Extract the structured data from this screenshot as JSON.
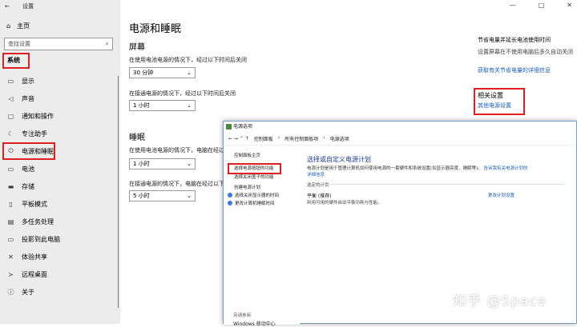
{
  "settings": {
    "window_title": "设置",
    "back_glyph": "←",
    "home_label": "主页",
    "search_placeholder": "查找设置",
    "section": "系统",
    "nav_items": [
      {
        "icon": "display-icon",
        "glyph": "▭",
        "label": "显示"
      },
      {
        "icon": "sound-icon",
        "glyph": "◁",
        "label": "声音"
      },
      {
        "icon": "notification-icon",
        "glyph": "▢",
        "label": "通知和操作"
      },
      {
        "icon": "focus-icon",
        "glyph": "☾",
        "label": "专注助手"
      },
      {
        "icon": "power-icon",
        "glyph": "⏻",
        "label": "电源和睡眠"
      },
      {
        "icon": "battery-icon",
        "glyph": "▭",
        "label": "电池"
      },
      {
        "icon": "storage-icon",
        "glyph": "▬",
        "label": "存储"
      },
      {
        "icon": "tablet-icon",
        "glyph": "▯",
        "label": "平板模式"
      },
      {
        "icon": "multitask-icon",
        "glyph": "▤",
        "label": "多任务处理"
      },
      {
        "icon": "project-icon",
        "glyph": "▭",
        "label": "投影到此电脑"
      },
      {
        "icon": "shared-icon",
        "glyph": "✕",
        "label": "体验共享"
      },
      {
        "icon": "remote-icon",
        "glyph": "≻",
        "label": "远程桌面"
      },
      {
        "icon": "about-icon",
        "glyph": "ⓘ",
        "label": "关于"
      }
    ],
    "window_controls": {
      "minimize": "—",
      "maximize": "□",
      "close": "✕"
    }
  },
  "main": {
    "title": "电源和睡眠",
    "screen": {
      "heading": "屏幕",
      "battery_label": "在使用电池电源的情况下，经过以下时间后关闭",
      "battery_value": "30 分钟",
      "plugged_label": "在接通电源的情况下，经过以下时间后关闭",
      "plugged_value": "1 小时"
    },
    "sleep": {
      "heading": "睡眠",
      "battery_label": "在使用电池电源的情况下，电脑在经过以下",
      "battery_value": "1 小时",
      "plugged_label": "在接通电源的情况下，电脑在经过以下",
      "plugged_value": "5 小时"
    },
    "chevron": "⌄",
    "right": {
      "tip_title": "节省电量并延长电池使用时间",
      "tip_desc": "设置屏幕在不使用电脑后多久自动关闭",
      "tip_link": "获取有关节省电量的详细信息",
      "related_title": "相关设置",
      "related_link": "其他电源设置"
    }
  },
  "control_panel": {
    "title": "电源选项",
    "nav_arrows": "←  →  ⌃  ↑",
    "crumbs": [
      "控制面板",
      "›",
      "所有控制面板项",
      "›",
      "电源选项"
    ],
    "left_items": [
      {
        "label": "控制面板主页"
      },
      {
        "label": "选择电源按钮的功能"
      },
      {
        "label": "选择关闭盖子的功能"
      },
      {
        "label": "创建电源计划"
      },
      {
        "label": "选择关闭显示器的时间"
      },
      {
        "label": "更改计算机睡眠时间"
      }
    ],
    "main_title": "选择或自定义电源计划",
    "desc": "电源计划是用于管理计算机如何使用电源的一套硬件和系统设置(如显示器亮度、睡眠等)。",
    "desc_link": "告诉我有关电源计划的详细信息",
    "selected_heading": "选定的计划",
    "plan_name": "平衡 (推荐)",
    "plan_desc": "利用可用的硬件自动平衡功耗与性能。",
    "change_link": "更改计划设置",
    "see_also": "另请参阅",
    "see_also_item": "Windows 移动中心"
  },
  "watermark": "知乎 @Space",
  "colors": {
    "highlight": "#e02020",
    "link": "#1a5fb4"
  }
}
